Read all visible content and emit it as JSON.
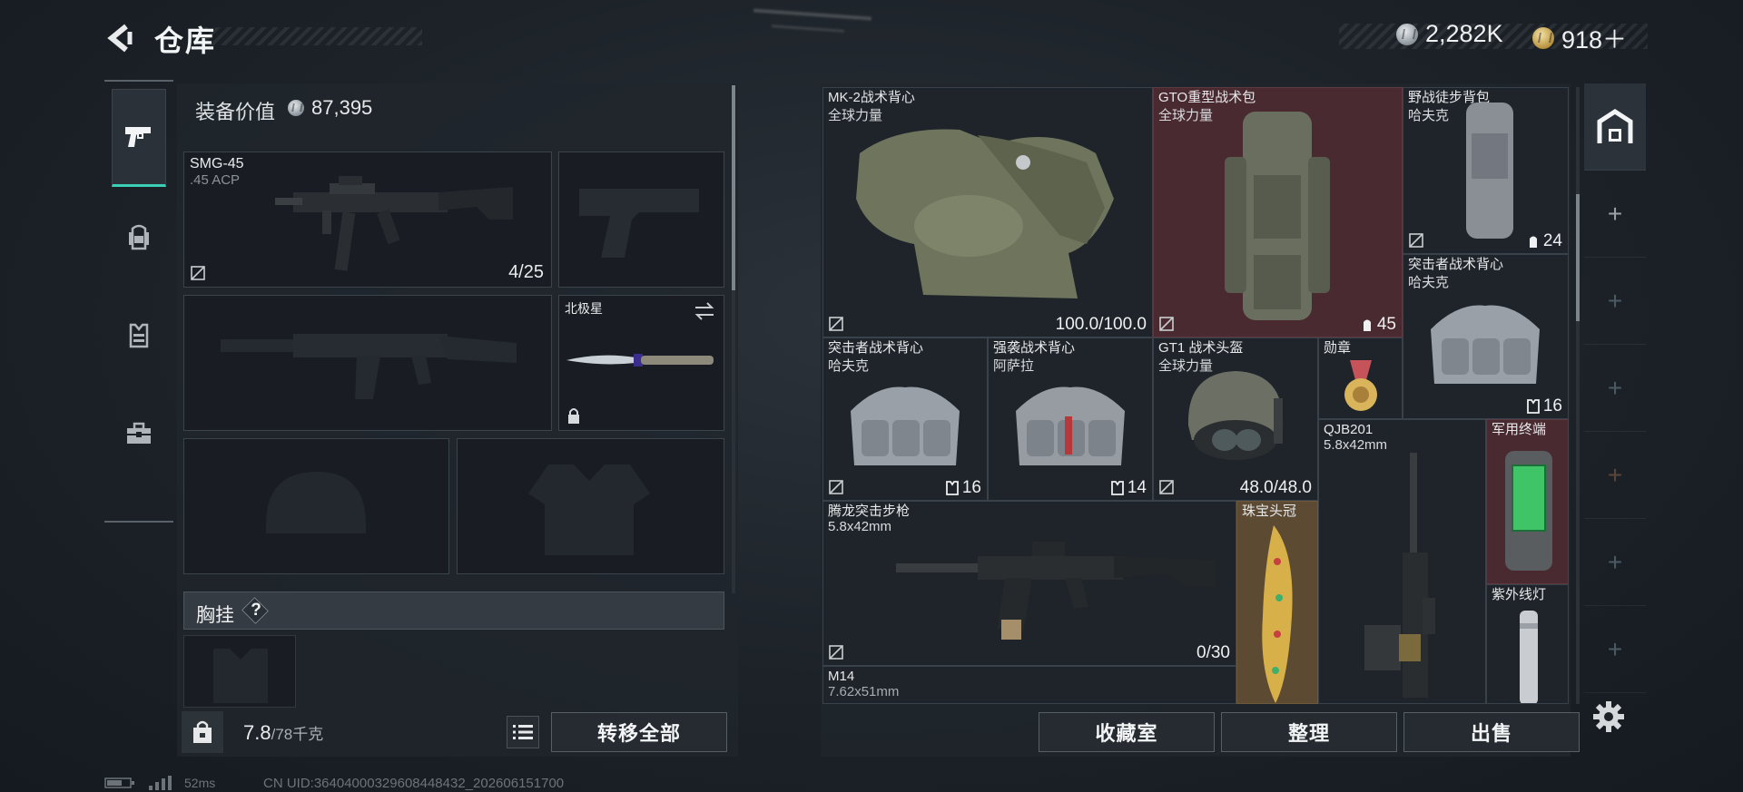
{
  "header": {
    "title": "仓库",
    "currency_silver": "2,282K",
    "currency_gold": "918＋"
  },
  "rail": {
    "icons": [
      "pistol-icon",
      "backpack-icon",
      "vest-icon",
      "toolbox-icon"
    ]
  },
  "equipment": {
    "value_label": "装备价值",
    "value": "87,395",
    "primary": {
      "name": "SMG-45",
      "caliber": ".45 ACP",
      "ammo": "4/25"
    },
    "melee": {
      "name": "北极星"
    },
    "chest_label": "胸挂",
    "help": "?",
    "weight_current": "7.8",
    "weight_max": "/78千克",
    "transfer_all": "转移全部"
  },
  "stash": {
    "items": [
      {
        "name": "MK-2战术背心",
        "sub": "全球力量",
        "value": "100.0/100.0"
      },
      {
        "name": "GTO重型战术包",
        "sub": "全球力量",
        "count": "45"
      },
      {
        "name": "野战徒步背包",
        "sub": "哈夫克",
        "count": "24"
      },
      {
        "name": "突击者战术背心",
        "sub": "哈夫克",
        "count": "16"
      },
      {
        "name": "突击者战术背心",
        "sub": "哈夫克",
        "count": "16"
      },
      {
        "name": "强袭战术背心",
        "sub": "阿萨拉",
        "count": "14"
      },
      {
        "name": "GT1 战术头盔",
        "sub": "全球力量",
        "value": "48.0/48.0"
      },
      {
        "name": "勋章"
      },
      {
        "name": "QJB201",
        "sub": "5.8x42mm"
      },
      {
        "name": "军用终端"
      },
      {
        "name": "腾龙突击步枪",
        "sub": "5.8x42mm",
        "value": "0/30"
      },
      {
        "name": "珠宝头冠"
      },
      {
        "name": "紫外线灯"
      },
      {
        "name": "M14",
        "sub": "7.62x51mm"
      }
    ]
  },
  "actions": {
    "collection": "收藏室",
    "organize": "整理",
    "sell": "出售"
  },
  "status": {
    "ping": "52ms",
    "uid": "CN UID:36404000329608448432_202606151700"
  }
}
